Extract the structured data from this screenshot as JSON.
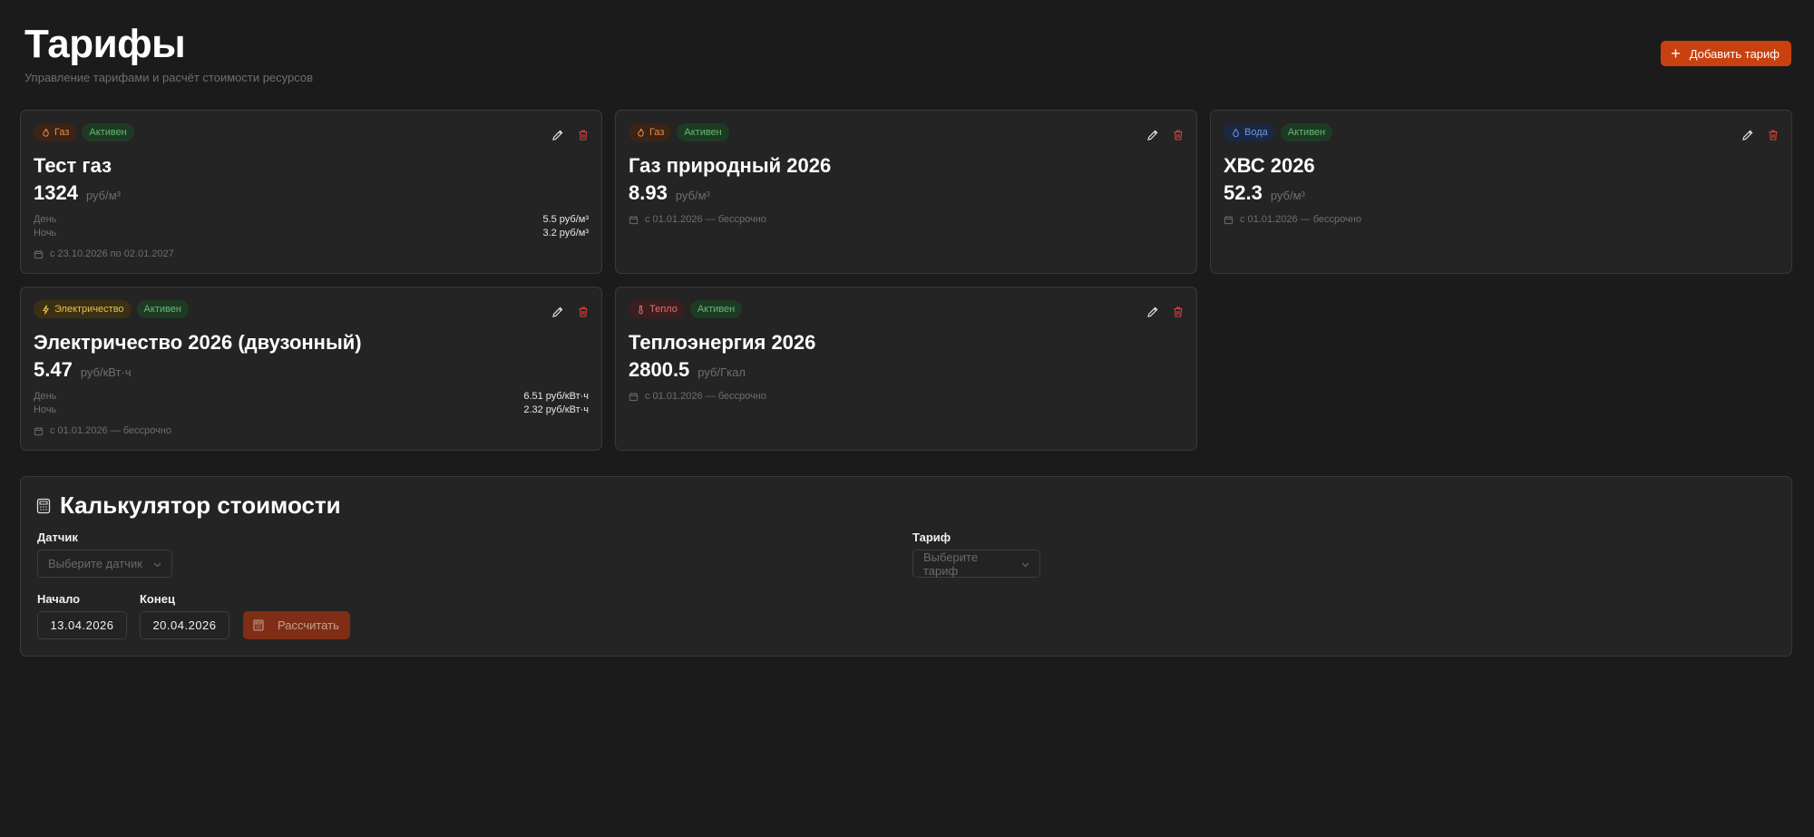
{
  "header": {
    "title": "Тарифы",
    "subtitle": "Управление тарифами и расчёт стоимости ресурсов",
    "add_button": "Добавить тариф"
  },
  "status_active": "Активен",
  "tariffs": [
    {
      "type_label": "Газ",
      "type_icon": "flame-icon",
      "name": "Тест газ",
      "price": "1324",
      "unit": "руб/м³",
      "zones": [
        {
          "label": "День",
          "value": "5.5 руб/м³"
        },
        {
          "label": "Ночь",
          "value": "3.2 руб/м³"
        }
      ],
      "period": "с 23.10.2026 по 02.01.2027"
    },
    {
      "type_label": "Газ",
      "type_icon": "flame-icon",
      "name": "Газ природный 2026",
      "price": "8.93",
      "unit": "руб/м³",
      "zones": [],
      "period": "с 01.01.2026 — бессрочно"
    },
    {
      "type_label": "Вода",
      "type_icon": "droplet-icon",
      "name": "ХВС 2026",
      "price": "52.3",
      "unit": "руб/м³",
      "zones": [],
      "period": "с 01.01.2026 — бессрочно"
    },
    {
      "type_label": "Электричество",
      "type_icon": "lightning-icon",
      "name": "Электричество 2026 (двузонный)",
      "price": "5.47",
      "unit": "руб/кВт·ч",
      "zones": [
        {
          "label": "День",
          "value": "6.51 руб/кВт·ч"
        },
        {
          "label": "Ночь",
          "value": "2.32 руб/кВт·ч"
        }
      ],
      "period": "с 01.01.2026 — бессрочно"
    },
    {
      "type_label": "Тепло",
      "type_icon": "thermometer-icon",
      "name": "Теплоэнергия 2026",
      "price": "2800.5",
      "unit": "руб/Гкал",
      "zones": [],
      "period": "с 01.01.2026 — бессрочно"
    }
  ],
  "calculator": {
    "title": "Калькулятор стоимости",
    "sensor_label": "Датчик",
    "sensor_placeholder": "Выберите датчик",
    "tariff_label": "Тариф",
    "tariff_placeholder": "Выберите тариф",
    "start_label": "Начало",
    "start_value": "13.04.2026",
    "end_label": "Конец",
    "end_value": "20.04.2026",
    "calculate_button": "Рассчитать"
  },
  "colors": {
    "accent": "#c9410f",
    "background": "#1b1b1b",
    "card": "#242424",
    "active_green": "#5fbf6d"
  }
}
